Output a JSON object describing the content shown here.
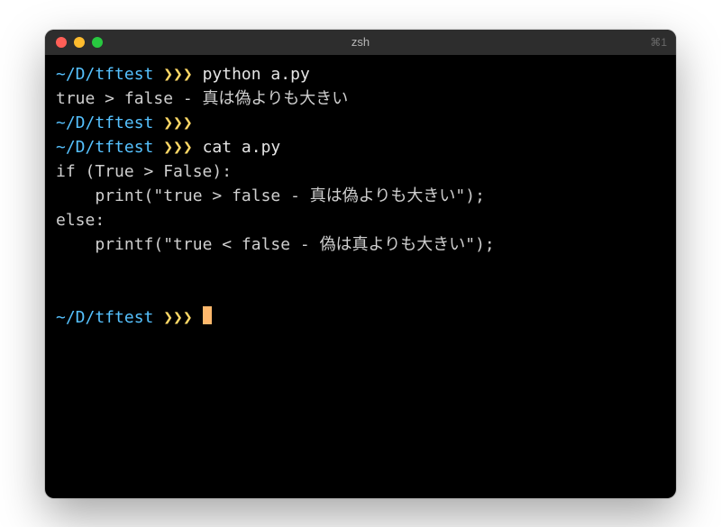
{
  "window": {
    "title": "zsh",
    "right_hint": "⌘1"
  },
  "colors": {
    "cwd": "#56c2ff",
    "prompt": "#ffd866",
    "cursor": "#ffb86c"
  },
  "prompt": {
    "cwd": "~/D/tftest",
    "symbol": "❯❯❯"
  },
  "session": [
    {
      "type": "prompt",
      "command": "python a.py"
    },
    {
      "type": "output",
      "text": "true > false - 真は偽よりも大きい"
    },
    {
      "type": "prompt",
      "command": ""
    },
    {
      "type": "prompt",
      "command": "cat a.py"
    },
    {
      "type": "output",
      "text": "if (True > False):"
    },
    {
      "type": "output",
      "text": "    print(\"true > false - 真は偽よりも大きい\");"
    },
    {
      "type": "output",
      "text": "else:"
    },
    {
      "type": "output",
      "text": "    printf(\"true < false - 偽は真よりも大きい\");"
    },
    {
      "type": "blank"
    },
    {
      "type": "blank"
    },
    {
      "type": "prompt",
      "command": "",
      "cursor": true
    }
  ]
}
